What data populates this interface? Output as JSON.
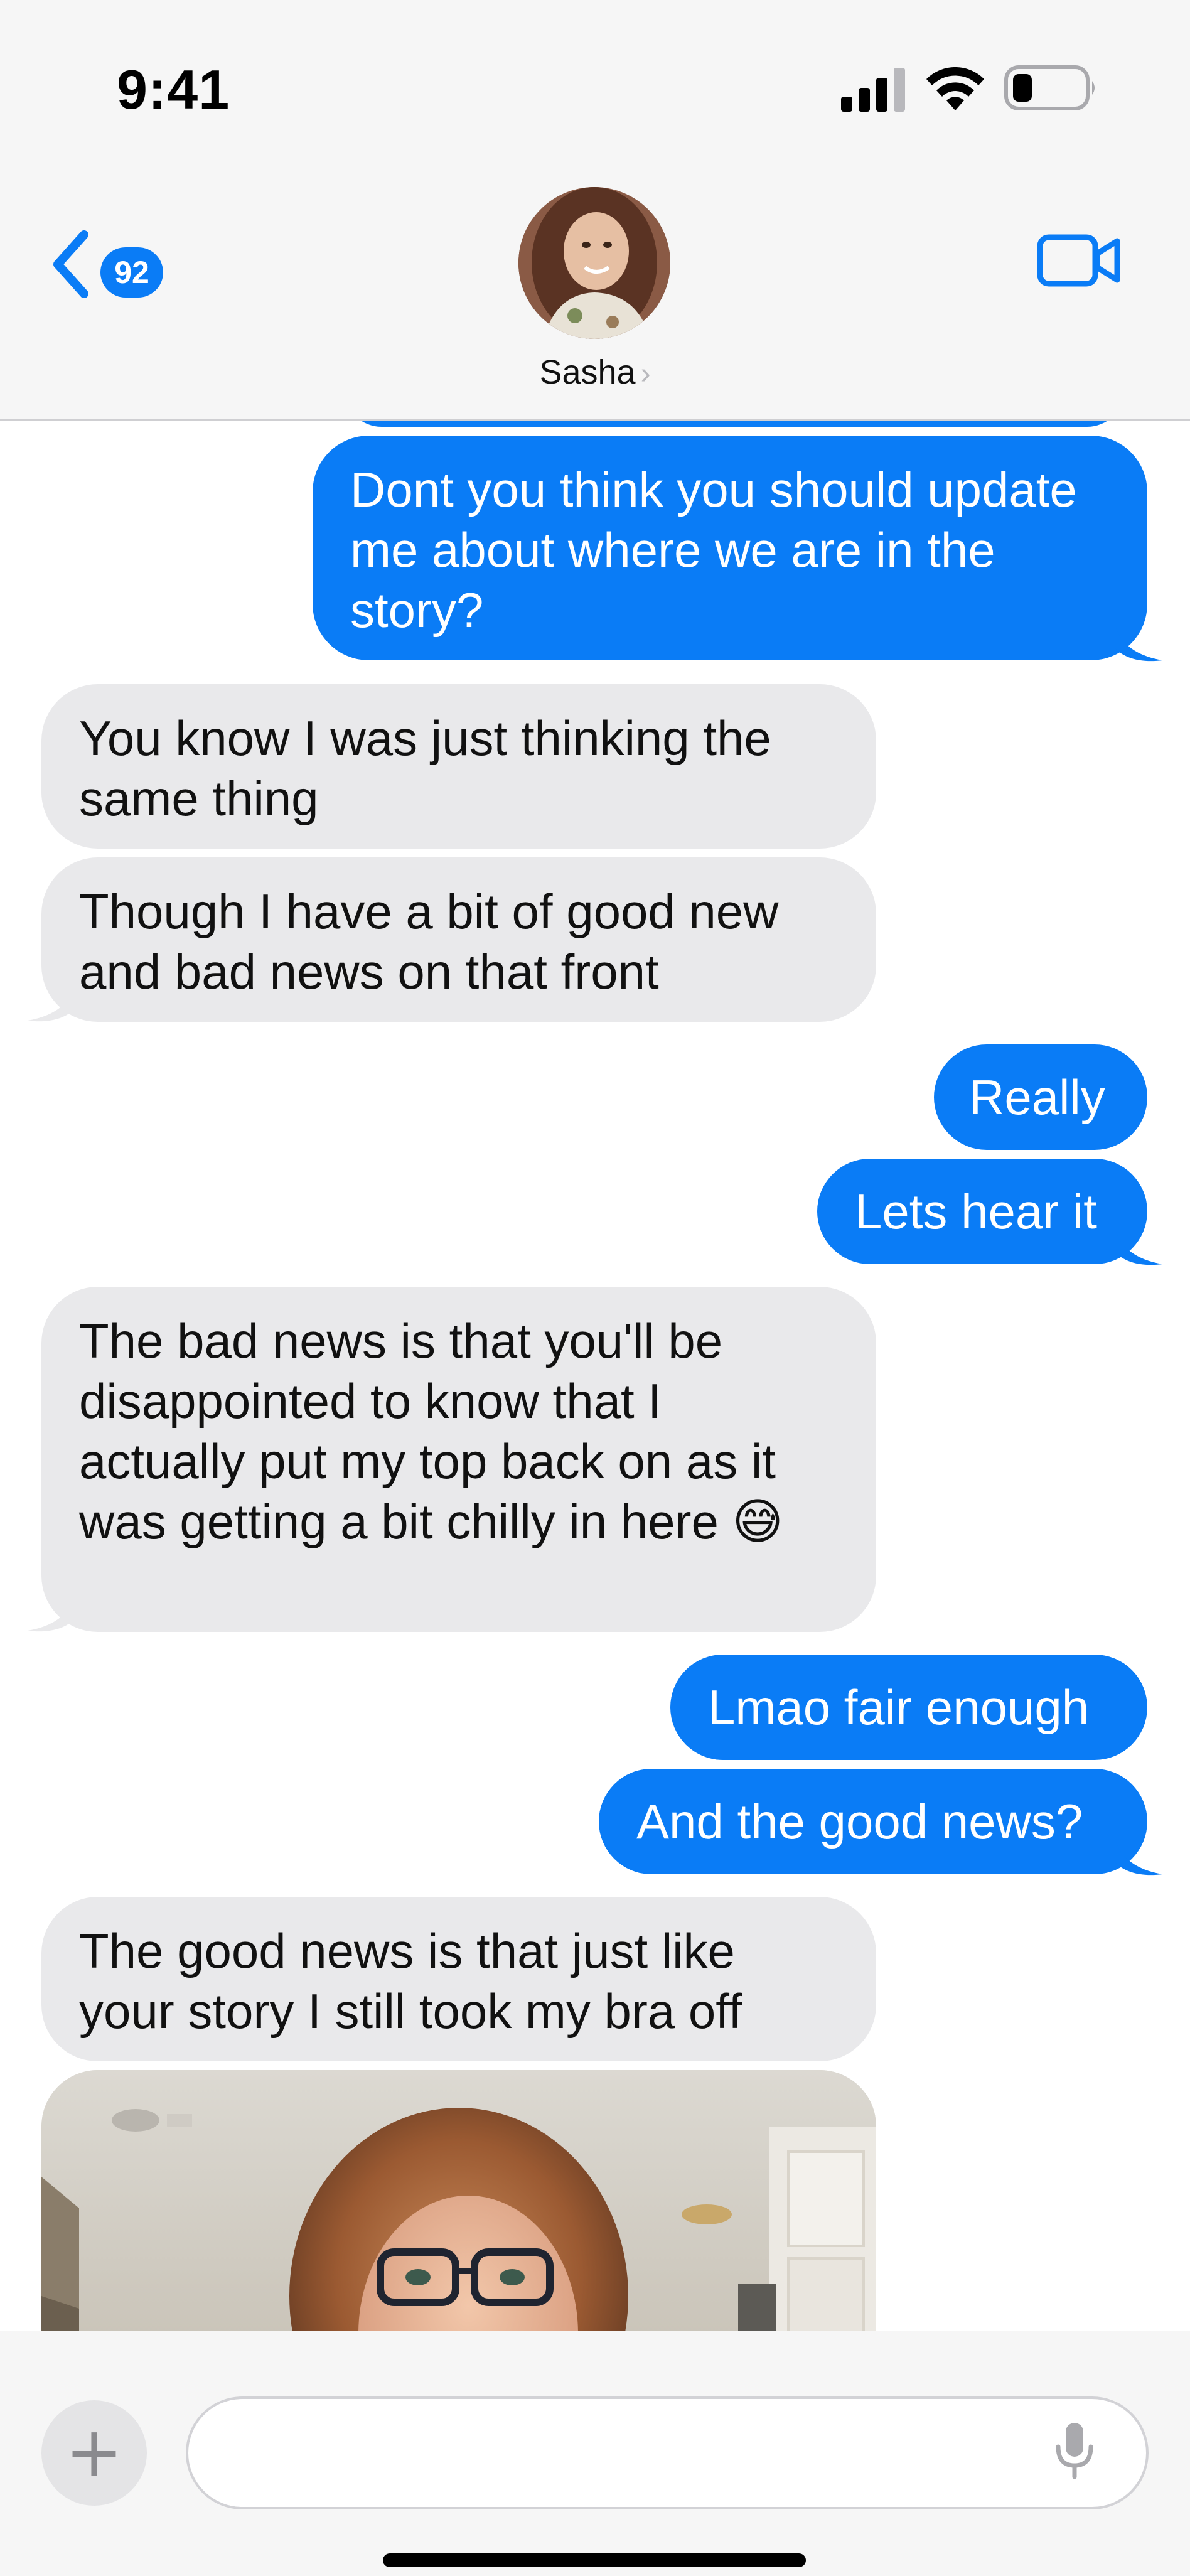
{
  "status_bar": {
    "time": "9:41"
  },
  "header": {
    "back_badge": "92",
    "contact_name": "Sasha",
    "name_chevron": "›"
  },
  "messages": [
    {
      "direction": "outgoing",
      "text": "Dont you think you should update me about where we are in the story?"
    },
    {
      "direction": "incoming",
      "text": "You know I was just thinking the same thing"
    },
    {
      "direction": "incoming",
      "text": "Though I have a bit of good new and bad news on that front"
    },
    {
      "direction": "outgoing",
      "text": "Really"
    },
    {
      "direction": "outgoing",
      "text": "Lets hear it"
    },
    {
      "direction": "incoming",
      "text": "The bad news is that you'll be disappointed to know that I actually put my top back on as it was getting a bit chilly in here 😅"
    },
    {
      "direction": "outgoing",
      "text": "Lmao fair enough"
    },
    {
      "direction": "outgoing",
      "text": "And the good news?"
    },
    {
      "direction": "incoming",
      "text": "The good news is that just like your story I still took my bra off"
    },
    {
      "direction": "incoming",
      "type": "photo"
    }
  ],
  "composer": {
    "plus_label": "+",
    "input_value": "",
    "input_placeholder": ""
  },
  "colors": {
    "outgoing_bubble": "#0a7cf6",
    "incoming_bubble": "#e9e9eb",
    "header_bg": "#f6f6f6",
    "accent": "#0a7cf6"
  },
  "icons": {
    "signal": "signal-bars-icon",
    "wifi": "wifi-icon",
    "battery": "battery-low-icon",
    "back": "chevron-left-icon",
    "facetime": "video-camera-icon",
    "plus": "plus-icon",
    "mic": "microphone-icon"
  }
}
